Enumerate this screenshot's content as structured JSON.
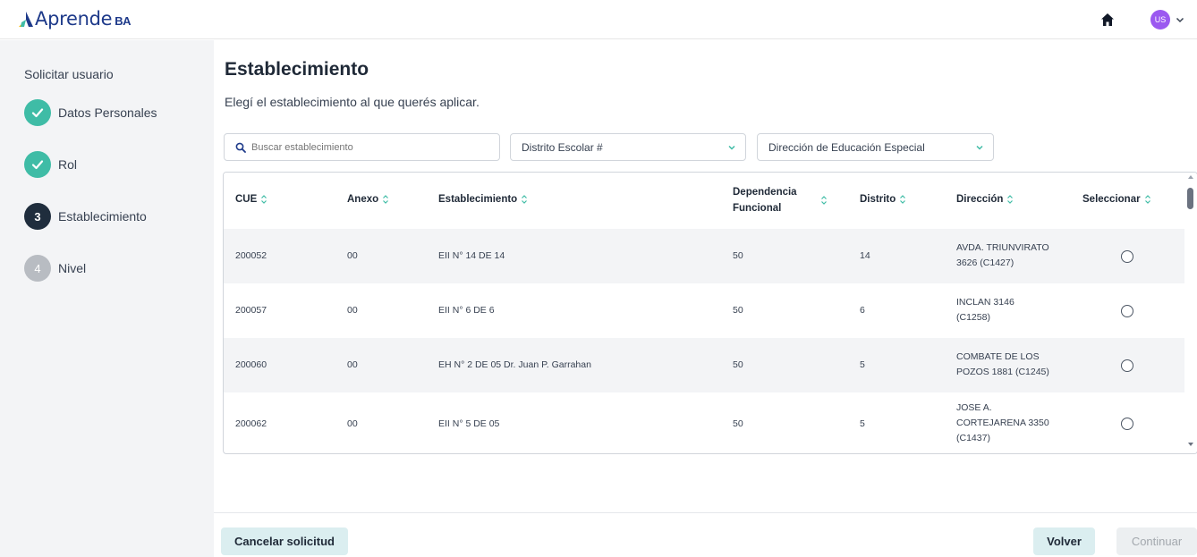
{
  "header": {
    "logo_text": "Aprende",
    "logo_ba": "BA",
    "avatar_initials": "US",
    "colors": {
      "brand": "#1e3a8a",
      "avatar": "#9b59f0"
    }
  },
  "sidebar": {
    "title": "Solicitar usuario",
    "steps": [
      {
        "number": "",
        "label": "Datos Personales",
        "status": "done"
      },
      {
        "number": "",
        "label": "Rol",
        "status": "done"
      },
      {
        "number": "3",
        "label": "Establecimiento",
        "status": "current"
      },
      {
        "number": "4",
        "label": "Nivel",
        "status": "todo"
      }
    ]
  },
  "main": {
    "title": "Establecimiento",
    "subtitle": "Elegí el establecimiento al que querés aplicar.",
    "search_placeholder": "Buscar establecimiento",
    "filter_distrito": "Distrito Escolar #",
    "filter_direccion": "Dirección de Educación Especial"
  },
  "table": {
    "headers": {
      "cue": "CUE",
      "anexo": "Anexo",
      "establecimiento": "Establecimiento",
      "dependencia_1": "Dependencia",
      "dependencia_2": "Funcional",
      "distrito": "Distrito",
      "direccion": "Dirección",
      "seleccionar": "Seleccionar"
    },
    "rows": [
      {
        "cue": "200052",
        "anexo": "00",
        "establecimiento": "EII N° 14 DE 14",
        "dependencia": "50",
        "distrito": "14",
        "direccion_1": "AVDA. TRIUNVIRATO",
        "direccion_2": "3626 (C1427)",
        "direccion_3": ""
      },
      {
        "cue": "200057",
        "anexo": "00",
        "establecimiento": "EII N° 6 DE 6",
        "dependencia": "50",
        "distrito": "6",
        "direccion_1": "INCLAN 3146",
        "direccion_2": "(C1258)",
        "direccion_3": ""
      },
      {
        "cue": "200060",
        "anexo": "00",
        "establecimiento": "EH N° 2 DE 05 Dr. Juan P. Garrahan",
        "dependencia": "50",
        "distrito": "5",
        "direccion_1": "COMBATE DE LOS",
        "direccion_2": "POZOS 1881 (C1245)",
        "direccion_3": ""
      },
      {
        "cue": "200062",
        "anexo": "00",
        "establecimiento": "EII N° 5 DE 05",
        "dependencia": "50",
        "distrito": "5",
        "direccion_1": "JOSE A.",
        "direccion_2": "CORTEJARENA 3350",
        "direccion_3": "(C1437)"
      }
    ]
  },
  "footer": {
    "cancel": "Cancelar solicitud",
    "back": "Volver",
    "next": "Continuar"
  }
}
